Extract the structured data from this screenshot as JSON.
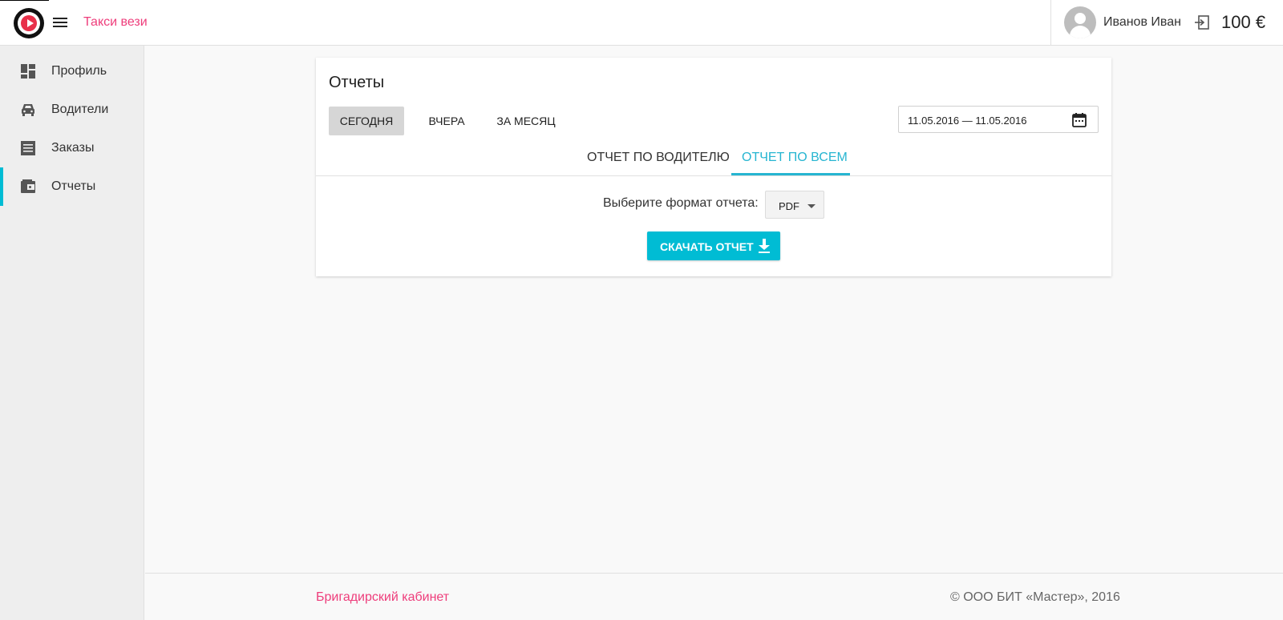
{
  "header": {
    "brand": "Такси вези",
    "user_name": "Иванов Иван",
    "balance": "100 €"
  },
  "sidebar": {
    "items": [
      {
        "label": "Профиль",
        "icon": "dashboard-icon"
      },
      {
        "label": "Водители",
        "icon": "car-icon"
      },
      {
        "label": "Заказы",
        "icon": "list-icon"
      },
      {
        "label": "Отчеты",
        "icon": "wallet-icon",
        "active": true
      }
    ]
  },
  "card": {
    "title": "Отчеты",
    "periods": [
      "СЕГОДНЯ",
      "ВЧЕРА",
      "ЗА МЕСЯЦ"
    ],
    "active_period": "СЕГОДНЯ",
    "date_range": "11.05.2016 — 11.05.2016",
    "tabs": [
      "ОТЧЕТ ПО ВОДИТЕЛЮ",
      "ОТЧЕТ ПО ВСЕМ"
    ],
    "active_tab": "ОТЧЕТ ПО ВСЕМ",
    "format_label": "Выберите формат отчета:",
    "format_value": "PDF",
    "download_label": "СКАЧАТЬ ОТЧЕТ"
  },
  "footer": {
    "left": "Бригадирский кабинет",
    "right": "© ООО БИТ «Мастер», 2016"
  },
  "colors": {
    "accent": "#00bcd4",
    "brand_pink": "#ee3d7b",
    "logo_red": "#e8304a"
  }
}
